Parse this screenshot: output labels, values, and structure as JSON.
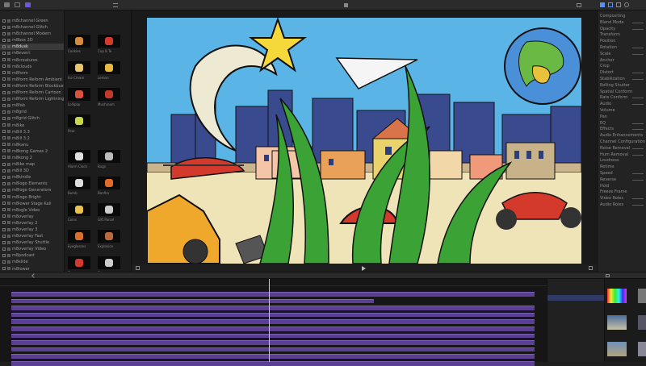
{
  "toolbar": {
    "library_label": "",
    "library_count": "",
    "viewer_info": "",
    "viewer_title": "",
    "zoom": ""
  },
  "library": {
    "items": [
      "m8channel Green",
      "m8channel Glitch",
      "m8channel Modern",
      "m8box 2D",
      "m8dusk",
      "m8event",
      "m8creatures",
      "m8clouds",
      "m8form",
      "m8form Reform Ambient",
      "m8form Reform Blockbuster",
      "m8form Reform Cartoon",
      "m8form Reform Lightning",
      "m8fab",
      "m8grid",
      "m8grid Glitch",
      "m8ike",
      "m8ill 3.3",
      "m8ill 3.2",
      "m8kanu",
      "m8kong Games 2",
      "m8kong 2",
      "m8ike map",
      "m8ill 3D",
      "m8kindle",
      "m8logo Elements",
      "m8logo Generators",
      "m8logo Bright",
      "m8lower Stage Kali",
      "m8ogle Video",
      "m8overlay",
      "m8overlay 2",
      "m8overlay 3",
      "m8overlay Fast",
      "m8overlay Shuttle",
      "m8overlay Video",
      "m8podcast",
      "m8slide",
      "m8lower",
      "m8lower 2"
    ],
    "selected_index": 4
  },
  "browser": {
    "tab_a": "",
    "tab_b": "",
    "section_1": "",
    "section_2": "",
    "tiles": [
      {
        "label": "Cookies",
        "color": "#d58a3c"
      },
      {
        "label": "Cup 8 Te",
        "color": "#d33a2c"
      },
      {
        "label": "Ice Cream",
        "color": "#e8c56a"
      },
      {
        "label": "Lemon",
        "color": "#e8b93b"
      },
      {
        "label": "Lollipop",
        "color": "#d9543a"
      },
      {
        "label": "Mushroom",
        "color": "#c0392b"
      },
      {
        "label": "Pear",
        "color": "#c8d84a"
      },
      {
        "label": "Alarm Clock",
        "color": "#e0e0e0"
      },
      {
        "label": "Bugs",
        "color": "#bbbbbb"
      },
      {
        "label": "Bomb",
        "color": "#dddddd"
      },
      {
        "label": "Bonfire",
        "color": "#e06a2a"
      },
      {
        "label": "Coins",
        "color": "#e8c24a"
      },
      {
        "label": "Gift Parcel",
        "color": "#cccccc"
      },
      {
        "label": "Eyeglasses",
        "color": "#d8702a"
      },
      {
        "label": "Explosion",
        "color": "#b86a3a"
      },
      {
        "label": "Flag",
        "color": "#d33a2c"
      },
      {
        "label": "Flower",
        "color": "#cccccc"
      }
    ]
  },
  "inspector": {
    "rows": [
      "Compositing",
      "Blend Mode",
      "Opacity",
      "Transform",
      "Position",
      "Rotation",
      "Scale",
      "Anchor",
      "Crop",
      "Distort",
      "Stabilization",
      "Rolling Shutter",
      "Spatial Conform",
      "Rate Conform",
      "Audio",
      "Volume",
      "Pan",
      "EQ",
      "Effects",
      "Audio Enhancements",
      "Channel Configuration",
      "Noise Removal",
      "Hum Removal",
      "Loudness",
      "Retime",
      "Speed",
      "Reverse",
      "Hold",
      "Freeze Frame",
      "Video Roles",
      "Audio Roles"
    ]
  },
  "timeline": {
    "index_label": "",
    "title": "",
    "duration": "",
    "ticks": [
      "",
      "",
      "",
      "",
      "",
      ""
    ],
    "tracks": [
      {
        "name": "",
        "end": 0.98
      },
      {
        "name": "",
        "end": 0.68
      },
      {
        "name": "",
        "end": 0.98
      },
      {
        "name": "",
        "end": 0.98
      },
      {
        "name": "",
        "end": 0.98
      },
      {
        "name": "",
        "end": 0.98
      },
      {
        "name": "",
        "end": 0.98
      },
      {
        "name": "",
        "end": 0.98
      },
      {
        "name": "",
        "end": 0.98
      },
      {
        "name": "",
        "end": 0.98
      },
      {
        "name": "",
        "end": 0.98
      }
    ]
  },
  "effects": {
    "title": "",
    "items": [
      "",
      "",
      "",
      "",
      "",
      "",
      "",
      "",
      ""
    ],
    "selected_index": 1
  },
  "thumbs": {
    "title": ""
  },
  "colors": {
    "accent": "#5a3f92",
    "selection": "#2f3a66",
    "sky": "#5bb4e6",
    "grass": "#3ba335"
  }
}
